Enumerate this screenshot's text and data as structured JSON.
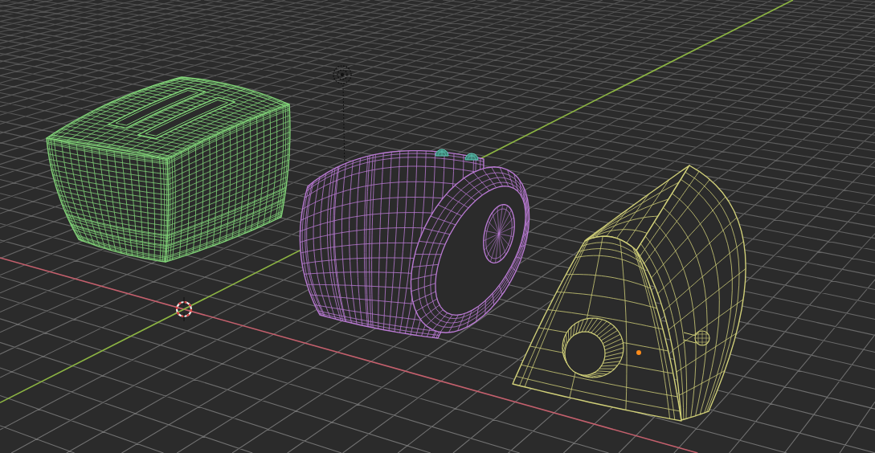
{
  "viewport": {
    "axes": [
      {
        "kind": "x",
        "color": "#c4606d"
      },
      {
        "kind": "y",
        "color": "#8db543"
      }
    ],
    "objects": [
      {
        "kind": "box",
        "color": "#82d478",
        "selected": false
      },
      {
        "kind": "capsule",
        "color": "#b97ad3",
        "selected": false
      },
      {
        "kind": "dome",
        "color": "#d0cf78",
        "selected": true
      }
    ]
  }
}
